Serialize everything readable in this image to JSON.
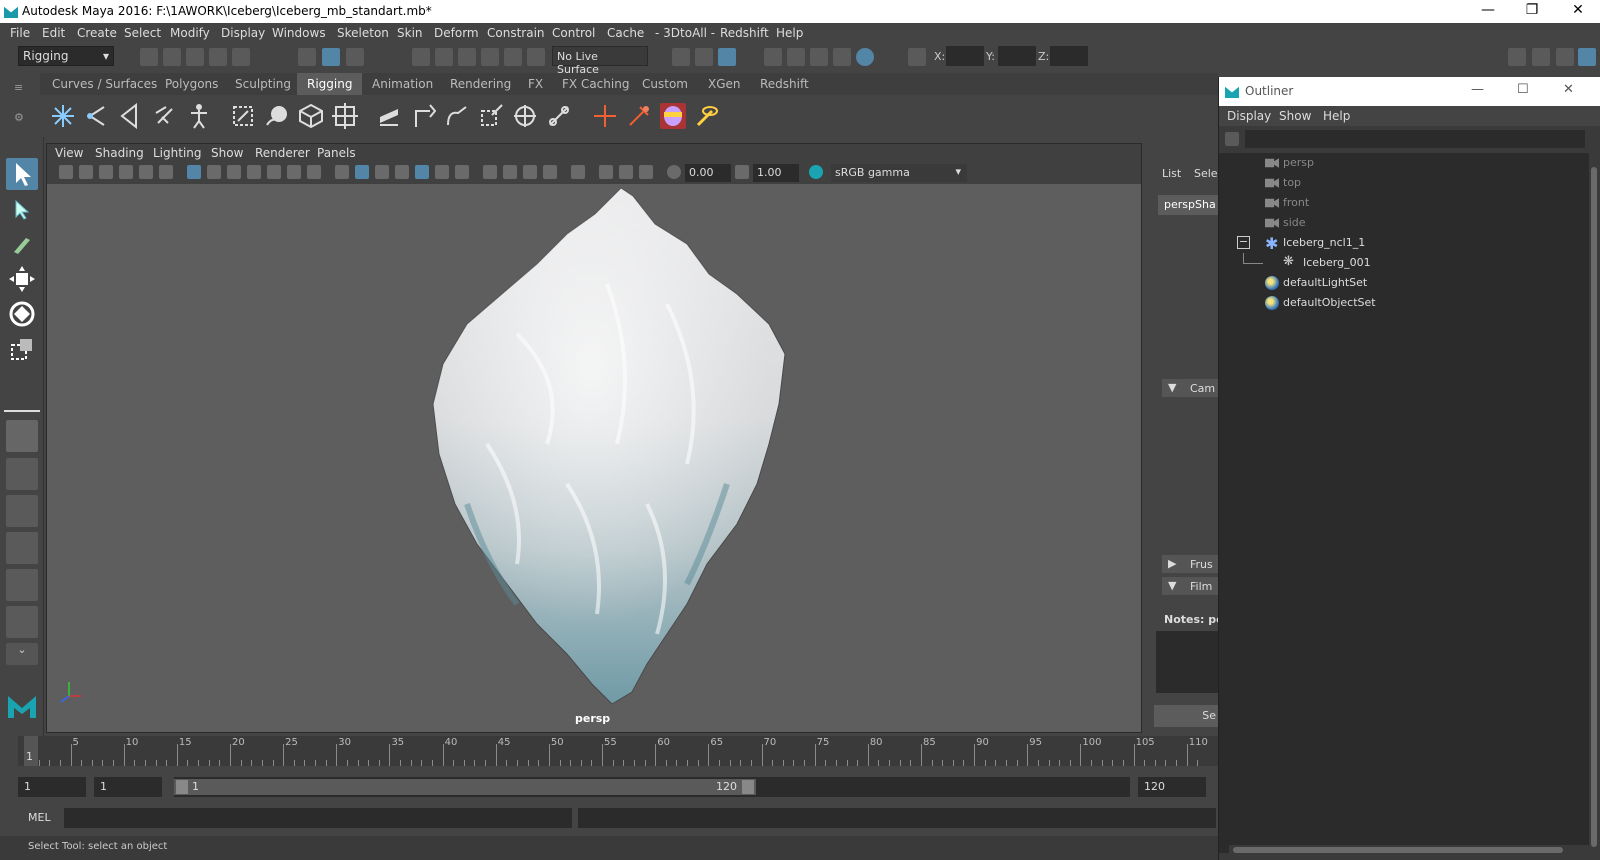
{
  "window": {
    "title": "Autodesk Maya 2016: F:\\1AWORK\\Iceberg\\Iceberg_mb_standart.mb*",
    "minimize": "—",
    "restore": "❐",
    "close": "✕"
  },
  "menubar": [
    "File",
    "Edit",
    "Create",
    "Select",
    "Modify",
    "Display",
    "Windows",
    "Skeleton",
    "Skin",
    "Deform",
    "Constrain",
    "Control",
    "Cache",
    "- 3DtoAll -",
    "Redshift",
    "Help"
  ],
  "statusline": {
    "mode": "Rigging",
    "live_surface": "No Live Surface",
    "x_label": "X:",
    "y_label": "Y:",
    "z_label": "Z:"
  },
  "shelf_tabs": [
    "Curves / Surfaces",
    "Polygons",
    "Sculpting",
    "Rigging",
    "Animation",
    "Rendering",
    "FX",
    "FX Caching",
    "Custom",
    "XGen",
    "Redshift"
  ],
  "shelf_active": "Rigging",
  "viewport": {
    "menu": [
      "View",
      "Shading",
      "Lighting",
      "Show",
      "Renderer",
      "Panels"
    ],
    "exposure": "0.00",
    "gamma": "1.00",
    "color_space": "sRGB gamma",
    "camera_label": "persp"
  },
  "attr_panel": {
    "list_label": "List",
    "select_label": "Selec",
    "shape_tab": "perspSha",
    "cam_section": "Cam",
    "frus_section": "Frus",
    "film_section": "Film",
    "notes_label": "Notes: pe",
    "se_button": "Se"
  },
  "outliner": {
    "title": "Outliner",
    "menu": [
      "Display",
      "Show",
      "Help"
    ],
    "items": [
      {
        "label": "persp",
        "icon": "camera-icon",
        "dim": true,
        "indent": 0
      },
      {
        "label": "top",
        "icon": "camera-icon",
        "dim": true,
        "indent": 0
      },
      {
        "label": "front",
        "icon": "camera-icon",
        "dim": true,
        "indent": 0
      },
      {
        "label": "side",
        "icon": "camera-icon",
        "dim": true,
        "indent": 0
      },
      {
        "label": "Iceberg_ncl1_1",
        "icon": "nucleus-icon",
        "dim": false,
        "indent": 0,
        "expander": "−"
      },
      {
        "label": "Iceberg_001",
        "icon": "ncloth-icon",
        "dim": false,
        "indent": 1
      },
      {
        "label": "defaultLightSet",
        "icon": "set-icon",
        "dim": false,
        "indent": 0
      },
      {
        "label": "defaultObjectSet",
        "icon": "set-icon",
        "dim": false,
        "indent": 0
      }
    ]
  },
  "timeline": {
    "ticks": [
      5,
      10,
      15,
      20,
      25,
      30,
      35,
      40,
      45,
      50,
      55,
      60,
      65,
      70,
      75,
      80,
      85,
      90,
      95,
      100,
      105,
      110
    ],
    "current_frame": "1",
    "range_start": "1",
    "playback_start": "1",
    "slider_start": "1",
    "slider_end": "120",
    "range_end": "120"
  },
  "cmdline": {
    "label": "MEL"
  },
  "helpline": {
    "text": "Select Tool: select an object"
  }
}
